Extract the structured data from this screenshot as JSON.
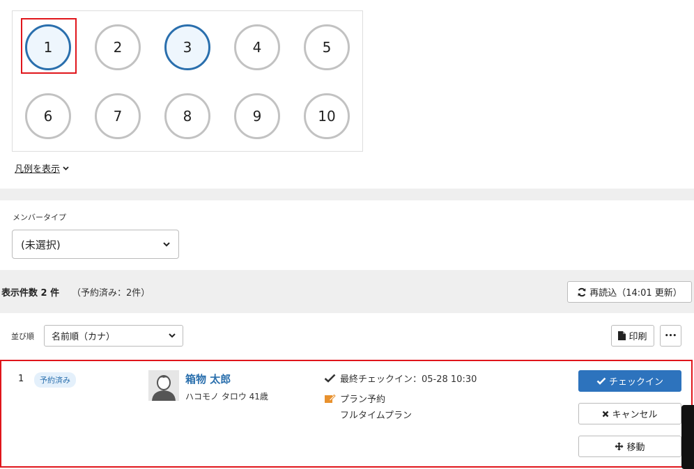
{
  "seats": [
    {
      "number": "1",
      "state": "selected"
    },
    {
      "number": "2",
      "state": "empty"
    },
    {
      "number": "3",
      "state": "selected"
    },
    {
      "number": "4",
      "state": "empty"
    },
    {
      "number": "5",
      "state": "empty"
    },
    {
      "number": "6",
      "state": "empty"
    },
    {
      "number": "7",
      "state": "empty"
    },
    {
      "number": "8",
      "state": "empty"
    },
    {
      "number": "9",
      "state": "empty"
    },
    {
      "number": "10",
      "state": "empty"
    }
  ],
  "legend_link": "凡例を表示",
  "member_type": {
    "label": "メンバータイプ",
    "value": "(未選択)"
  },
  "summary": {
    "count": "表示件数 2 件",
    "status": "（予約済み：2件）"
  },
  "reload_button": "再読込（14:01 更新）",
  "sort": {
    "label": "並び順",
    "value": "名前順（カナ）"
  },
  "print_button": "印刷",
  "more_button": "•••",
  "reservation": {
    "index": "1",
    "status_badge": "予約済み",
    "name": "箱物 太郎",
    "kana_age": "ハコモノ タロウ 41歳",
    "last_checkin": "最終チェックイン：05-28 10:30",
    "plan_type": "プラン予約",
    "plan_name": "フルタイムプラン"
  },
  "actions": {
    "checkin": "チェックイン",
    "cancel": "キャンセル",
    "move": "移動"
  },
  "colors": {
    "accent": "#2d73bd",
    "highlight": "#e0151b",
    "seat_border": "#c2c2c2"
  }
}
